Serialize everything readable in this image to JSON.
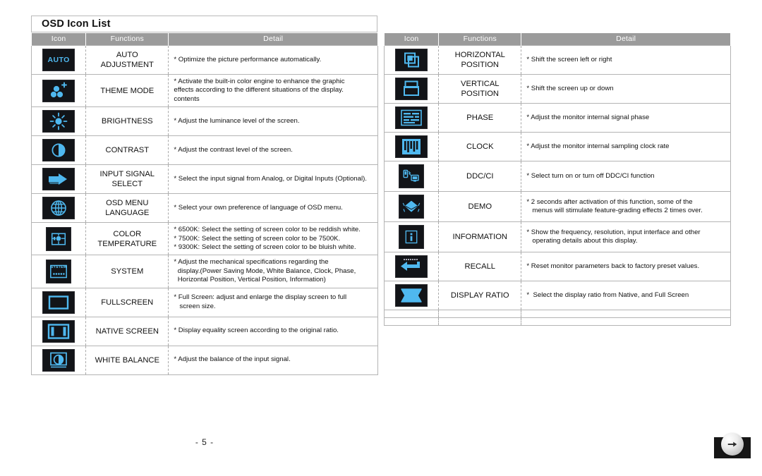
{
  "document": {
    "title": "OSD Icon List",
    "page_number": "- 5 -",
    "next_button_icon": "arrow-right-icon"
  },
  "colors": {
    "header_background": "#9b9b9b",
    "header_text": "#ffffff",
    "icon_tile_background": "#121418",
    "icon_glyph": "#4fb8ef",
    "table_border": "#b4b4b4",
    "inner_divider": "#a8a8a8"
  },
  "tables": [
    {
      "id": "left",
      "columns": [
        "Icon",
        "Functions",
        "Detail"
      ],
      "rows": [
        {
          "icon": "auto-adjustment-icon",
          "function": "AUTO\nADJUSTMENT",
          "detail": "* Optimize the picture performance automatically."
        },
        {
          "icon": "theme-mode-icon",
          "function": "THEME MODE",
          "detail": "* Activate the built-in color engine to enhance the graphic\neffects according to the different situations of the display.\ncontents"
        },
        {
          "icon": "brightness-icon",
          "function": "BRIGHTNESS",
          "detail": "* Adjust the luminance level of the screen."
        },
        {
          "icon": "contrast-icon",
          "function": "CONTRAST",
          "detail": "* Adjust the contrast level of the screen."
        },
        {
          "icon": "input-signal-select-icon",
          "function": "INPUT SIGNAL\nSELECT",
          "detail": "* Select the input signal from Analog, or Digital Inputs (Optional)."
        },
        {
          "icon": "osd-menu-language-icon",
          "function": "OSD MENU\nLANGUAGE",
          "detail": "* Select your own preference of language of OSD menu."
        },
        {
          "icon": "color-temperature-icon",
          "function": "COLOR\nTEMPERATURE",
          "detail": "* 6500K: Select the setting of screen color to be reddish white.\n* 7500K: Select the setting of screen color to be 7500K.\n* 9300K: Select the setting of screen color to be bluish white."
        },
        {
          "icon": "system-icon",
          "function": "SYSTEM",
          "detail": "* Adjust the mechanical specifications regarding the\n  display.(Power Saving Mode, White Balance, Clock, Phase,\n  Horizontal Position, Vertical Position, Information)"
        },
        {
          "icon": "fullscreen-icon",
          "function": "FULLSCREEN",
          "detail": "* Full Screen: adjust and enlarge the display screen to full\n   screen size."
        },
        {
          "icon": "native-screen-icon",
          "function": "NATIVE SCREEN",
          "detail": "* Display equality screen according to the original ratio."
        },
        {
          "icon": "white-balance-icon",
          "function": "WHITE BALANCE",
          "detail": "* Adjust the balance of the input signal."
        }
      ]
    },
    {
      "id": "right",
      "columns": [
        "Icon",
        "Functions",
        "Detail"
      ],
      "rows": [
        {
          "icon": "horizontal-position-icon",
          "function": "HORIZONTAL\nPOSITION",
          "detail": "* Shift the screen left or right"
        },
        {
          "icon": "vertical-position-icon",
          "function": "VERTICAL\nPOSITION",
          "detail": "* Shift the screen up or down"
        },
        {
          "icon": "phase-icon",
          "function": "PHASE",
          "detail": "* Adjust the monitor internal signal phase"
        },
        {
          "icon": "clock-icon",
          "function": "CLOCK",
          "detail": "* Adjust the monitor internal sampling clock rate"
        },
        {
          "icon": "ddc-ci-icon",
          "function": "DDC/CI",
          "detail": "* Select turn on or turn off DDC/CI function"
        },
        {
          "icon": "demo-icon",
          "function": "DEMO",
          "detail": "* 2 seconds after activation of this function, some of the\n   menus will stimulate feature-grading effects 2 times over."
        },
        {
          "icon": "information-icon",
          "function": "INFORMATION",
          "detail": "* Show the frequency, resolution, input interface and other\n   operating details about this display."
        },
        {
          "icon": "recall-icon",
          "function": "RECALL",
          "detail": "* Reset monitor parameters back to factory preset values."
        },
        {
          "icon": "display-ratio-icon",
          "function": "DISPLAY RATIO",
          "detail": "*  Select the display ratio from Native, and Full Screen"
        },
        {
          "icon": "",
          "function": "",
          "detail": ""
        },
        {
          "icon": "",
          "function": "",
          "detail": ""
        }
      ]
    }
  ]
}
